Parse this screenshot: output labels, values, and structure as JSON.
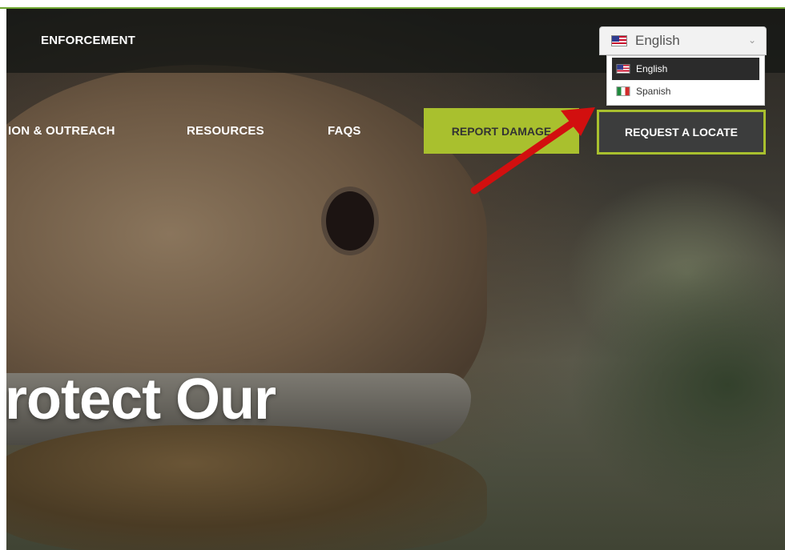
{
  "nav": {
    "enforcement": "ENFORCEMENT",
    "education": "ION & OUTREACH",
    "resources": "RESOURCES",
    "faqs": "FAQS",
    "report_damage": "REPORT DAMAGE",
    "request_locate": "REQUEST A LOCATE"
  },
  "language": {
    "selected": "English",
    "options": [
      "English",
      "Spanish"
    ]
  },
  "hero": {
    "title": "rotect Our"
  },
  "colors": {
    "accent": "#a9c02e",
    "annotation_arrow": "#d20f0f"
  }
}
